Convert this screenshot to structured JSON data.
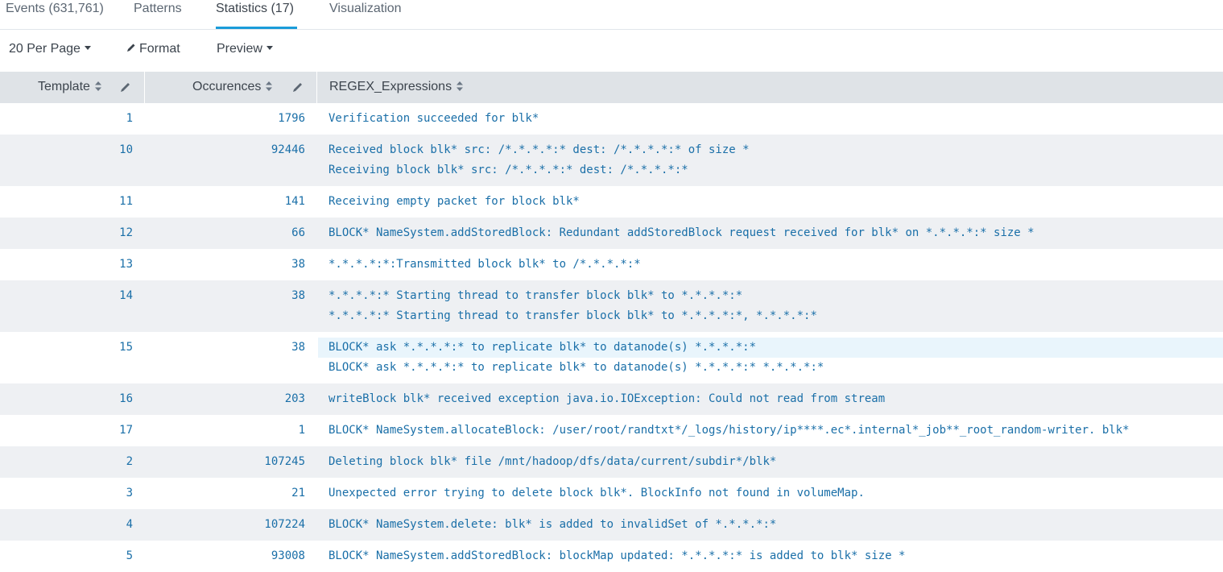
{
  "tabs": [
    {
      "label": "Events (631,761)"
    },
    {
      "label": "Patterns"
    },
    {
      "label": "Statistics (17)"
    },
    {
      "label": "Visualization"
    }
  ],
  "toolbar": {
    "per_page": "20 Per Page",
    "format": "Format",
    "preview": "Preview"
  },
  "table": {
    "columns": [
      "Template",
      "Occurences",
      "REGEX_Expressions"
    ],
    "rows": [
      {
        "template": "1",
        "occurrences": "1796",
        "regex": [
          "Verification succeeded for blk*"
        ]
      },
      {
        "template": "10",
        "occurrences": "92446",
        "regex": [
          "Received block blk* src: /*.*.*.*:* dest: /*.*.*.*:* of size *",
          "Receiving block blk* src: /*.*.*.*:* dest: /*.*.*.*:*"
        ]
      },
      {
        "template": "11",
        "occurrences": "141",
        "regex": [
          "Receiving empty packet for block blk*"
        ]
      },
      {
        "template": "12",
        "occurrences": "66",
        "regex": [
          "BLOCK* NameSystem.addStoredBlock: Redundant addStoredBlock request received for blk* on *.*.*.*:* size *"
        ]
      },
      {
        "template": "13",
        "occurrences": "38",
        "regex": [
          "*.*.*.*:*:Transmitted block blk* to /*.*.*.*:*"
        ]
      },
      {
        "template": "14",
        "occurrences": "38",
        "regex": [
          "*.*.*.*:* Starting thread to transfer block blk* to *.*.*.*:*",
          "*.*.*.*:* Starting thread to transfer block blk* to *.*.*.*:*, *.*.*.*:*"
        ]
      },
      {
        "template": "15",
        "occurrences": "38",
        "regex": [
          "BLOCK* ask *.*.*.*:* to replicate blk* to datanode(s) *.*.*.*:*",
          "BLOCK* ask *.*.*.*:* to replicate blk* to datanode(s) *.*.*.*:* *.*.*.*:*"
        ]
      },
      {
        "template": "16",
        "occurrences": "203",
        "regex": [
          "writeBlock blk* received exception java.io.IOException: Could not read from stream"
        ]
      },
      {
        "template": "17",
        "occurrences": "1",
        "regex": [
          "BLOCK* NameSystem.allocateBlock: /user/root/randtxt*/_logs/history/ip****.ec*.internal*_job**_root_random-writer. blk*"
        ]
      },
      {
        "template": "2",
        "occurrences": "107245",
        "regex": [
          "Deleting block blk* file /mnt/hadoop/dfs/data/current/subdir*/blk*"
        ]
      },
      {
        "template": "3",
        "occurrences": "21",
        "regex": [
          "Unexpected error trying to delete block blk*. BlockInfo not found in volumeMap."
        ]
      },
      {
        "template": "4",
        "occurrences": "107224",
        "regex": [
          "BLOCK* NameSystem.delete: blk* is added to invalidSet of *.*.*.*:*"
        ]
      },
      {
        "template": "5",
        "occurrences": "93008",
        "regex": [
          "BLOCK* NameSystem.addStoredBlock: blockMap updated: *.*.*.*:* is added to blk* size *"
        ]
      }
    ]
  }
}
